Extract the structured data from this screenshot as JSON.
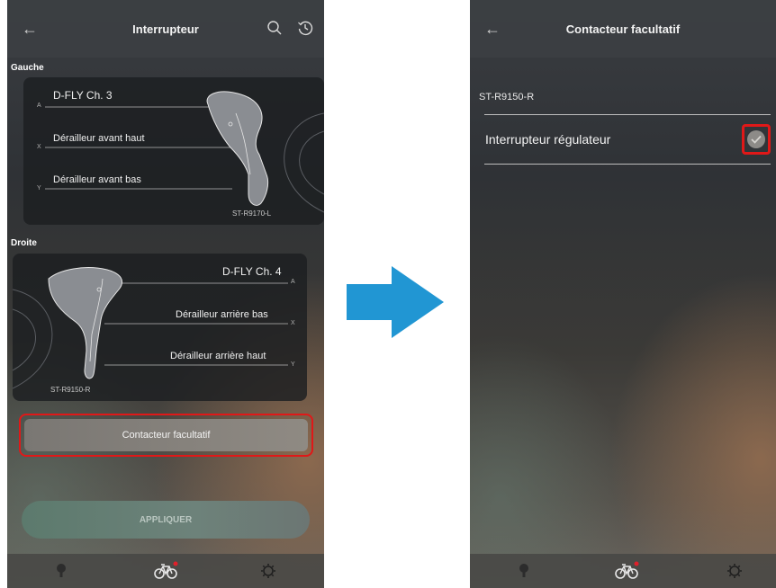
{
  "left_screen": {
    "title": "Interrupteur",
    "sections": {
      "left": {
        "label": "Gauche",
        "function_a": "D-FLY Ch. 3",
        "function_x": "Dérailleur avant haut",
        "function_y": "Dérailleur avant bas",
        "model": "ST-R9170-L",
        "pad_a": "A",
        "pad_x": "X",
        "pad_y": "Y"
      },
      "right": {
        "label": "Droite",
        "function_a": "D-FLY Ch. 4",
        "function_x": "Dérailleur arrière bas",
        "function_y": "Dérailleur arrière haut",
        "model": "ST-R9150-R",
        "pad_a": "A",
        "pad_x": "X",
        "pad_y": "Y"
      }
    },
    "optional_button": "Contacteur facultatif",
    "apply_button": "APPLIQUER"
  },
  "right_screen": {
    "title": "Contacteur facultatif",
    "model": "ST-R9150-R",
    "item_label": "Interrupteur régulateur",
    "item_checked": true
  },
  "icons": [
    "back-arrow-icon",
    "search-icon",
    "history-icon",
    "bulb-icon",
    "bicycle-icon",
    "gear-icon",
    "check-icon",
    "arrow-right-icon"
  ],
  "colors": {
    "highlight": "#e01818",
    "arrow": "#2196d3",
    "notification_dot": "#e0202a"
  }
}
